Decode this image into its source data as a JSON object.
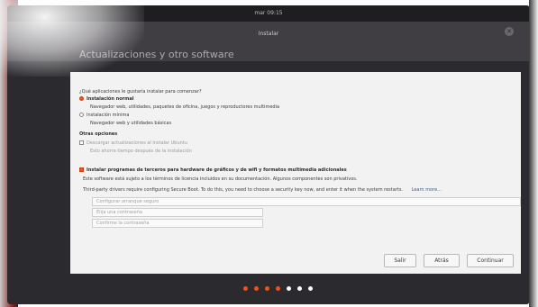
{
  "topbar": {
    "clock": "mar 09:15"
  },
  "window": {
    "title": "Instalar",
    "close_glyph": "✕"
  },
  "page": {
    "title": "Actualizaciones y otro software"
  },
  "question": "¿Qué aplicaciones le gustaría instalar para comenzar?",
  "install_options": [
    {
      "label": "Instalación normal",
      "selected": true
    },
    {
      "label": "Navegador web, utilidades, paquetes de oficina, juegos y reproductores multimedia",
      "selected": false,
      "faint": false
    },
    {
      "label": "Instalación mínima",
      "selected": false
    },
    {
      "label": "Navegador web y utilidades básicas",
      "selected": false,
      "faint": false
    }
  ],
  "other_options_heading": "Otras opciones",
  "other_options": [
    {
      "label": "Descargar actualizaciones al instalar Ubuntu"
    },
    {
      "label": "Esto ahorra tiempo después de la instalación"
    }
  ],
  "third_party": {
    "label": "Instalar programas de terceros para hardware de gráficos y de wifi y formatos multimedia adicionales",
    "checked": true,
    "note": "Este software está sujeto a los términos de licencia incluidos en su documentación. Algunos componentes son privativos."
  },
  "secure_boot": {
    "text": "Third-party drivers require configuring Secure Boot. To do this, you need to choose a security key now, and enter it when the system restarts.",
    "learn_more": "Learn more..."
  },
  "secure_boot_fields": [
    {
      "placeholder": "Configurar arranque seguro"
    },
    {
      "placeholder": "Elija una contraseña"
    },
    {
      "placeholder": "Confirme la contraseña"
    }
  ],
  "buttons": {
    "quit": "Salir",
    "back": "Atrás",
    "continue": "Continuar"
  },
  "progress": {
    "total_steps": 7,
    "completed_steps": 4
  },
  "colors": {
    "accent": "#e95420",
    "panel": "#f2f2f2",
    "chrome": "#2b2a2e"
  }
}
